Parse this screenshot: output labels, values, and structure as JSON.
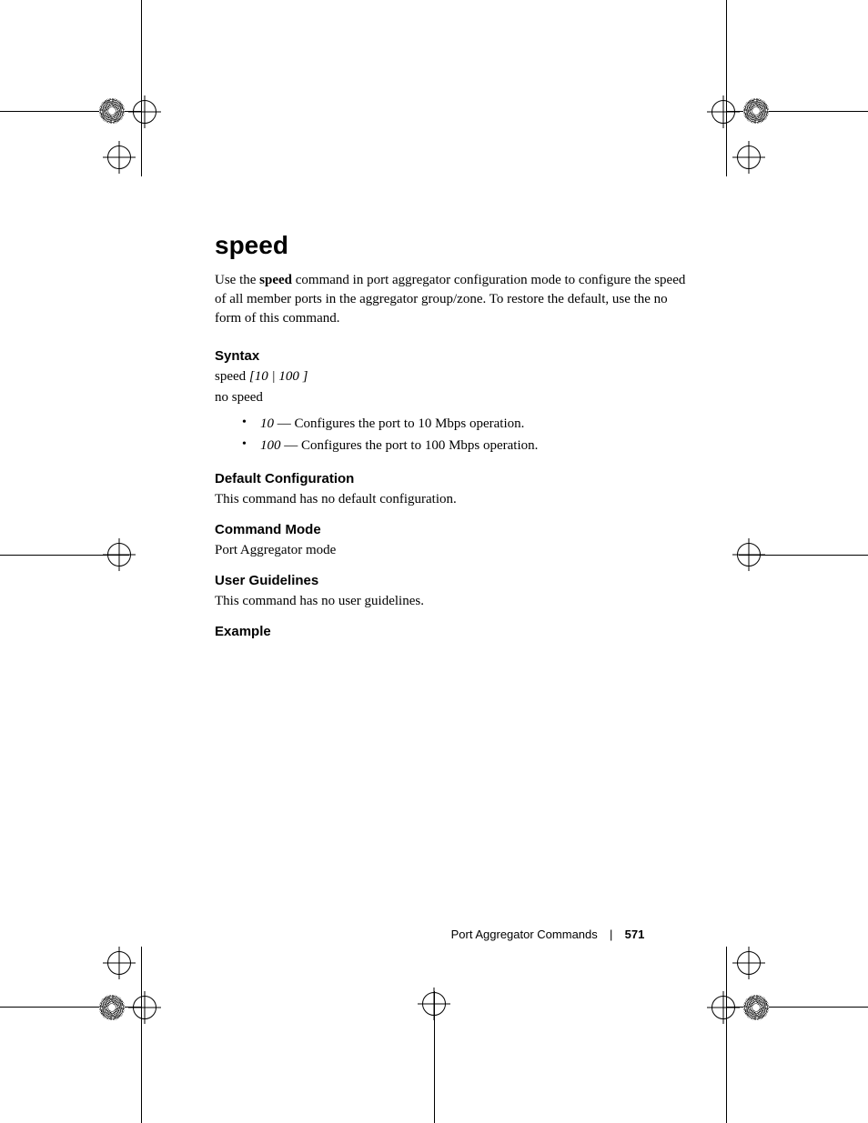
{
  "title": "speed",
  "intro_prefix": "Use the ",
  "intro_bold": "speed",
  "intro_suffix": " command in port aggregator configuration mode to configure the speed of all member ports in the aggregator group/zone. To restore the default, use the no form of this command.",
  "sections": {
    "syntax": {
      "heading": "Syntax",
      "cmd_prefix": "speed ",
      "cmd_args": "[10 | 100 ]",
      "no_form": "no speed",
      "params": [
        {
          "arg": "10",
          "desc": " — Configures the port to 10 Mbps operation."
        },
        {
          "arg": "100",
          "desc": " — Configures the port to 100 Mbps operation."
        }
      ]
    },
    "default_config": {
      "heading": "Default Configuration",
      "text": "This command has no default configuration."
    },
    "command_mode": {
      "heading": "Command Mode",
      "text": "Port Aggregator mode"
    },
    "user_guidelines": {
      "heading": "User Guidelines",
      "text": "This command has no user guidelines."
    },
    "example": {
      "heading": "Example"
    }
  },
  "footer": {
    "section_name": "Port Aggregator Commands",
    "separator": "|",
    "page_number": "571"
  }
}
